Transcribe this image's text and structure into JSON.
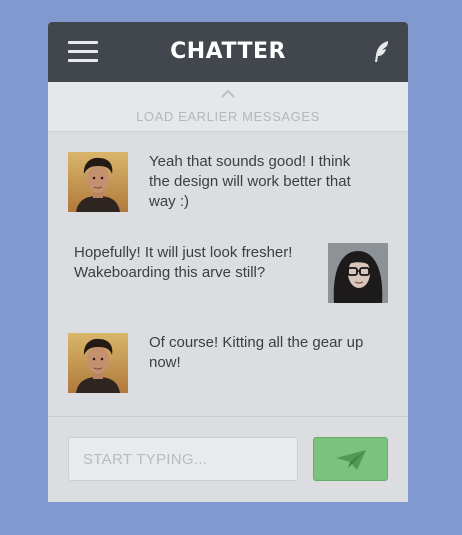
{
  "header": {
    "title": "CHATTER",
    "menu_icon": "hamburger-menu-icon",
    "right_icon": "feather-icon"
  },
  "load_more": {
    "label": "LOAD EARLIER MESSAGES",
    "icon": "chevron-up-icon"
  },
  "messages": [
    {
      "sender": "male-avatar",
      "side": "left",
      "text_lines": [
        "Yeah that sounds good! I think",
        "the design will work better that",
        "way :)"
      ]
    },
    {
      "sender": "female-avatar",
      "side": "right",
      "text_lines": [
        "Hopefully! It will just look fresher!",
        "Wakeboarding this arve still?"
      ]
    },
    {
      "sender": "male-avatar",
      "side": "left",
      "text_lines": [
        "Of course! Kitting all the gear up",
        "now!"
      ]
    }
  ],
  "composer": {
    "placeholder": "START TYPING...",
    "value": "",
    "send_icon": "paper-plane-icon"
  },
  "colors": {
    "background": "#8199cf",
    "header": "#42464d",
    "send_button": "#7ac27e"
  }
}
